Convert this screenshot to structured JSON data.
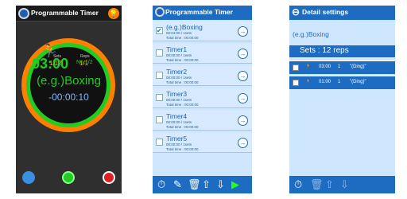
{
  "screen1": {
    "title": "Programmable Timer",
    "sets_label": "Sets",
    "sets_value": "1/12",
    "reps_label": "Reps",
    "reps_value": "1/1",
    "time": "03:00",
    "round": "No.1/2",
    "event": "(e.g.)Boxing",
    "remaining": "-00:00:10"
  },
  "screen2": {
    "title": "Programmable Timer",
    "timers": [
      {
        "name": "(e.g.)Boxing",
        "line1": "00:04:00 / 1sets",
        "line2": "Total time : 00:00:00",
        "checked": true
      },
      {
        "name": "Timer1",
        "line1": "00:00:00 / 1sets",
        "line2": "Total time : 00:00:00",
        "checked": false
      },
      {
        "name": "Timer2",
        "line1": "00:00:00 / 1sets",
        "line2": "Total time : 00:00:00",
        "checked": false
      },
      {
        "name": "Timer3",
        "line1": "00:00:00 / 1sets",
        "line2": "Total time : 00:00:00",
        "checked": false
      },
      {
        "name": "Timer4",
        "line1": "00:00:00 / 1sets",
        "line2": "Total time : 00:00:00",
        "checked": false
      },
      {
        "name": "Timer5",
        "line1": "00:00:00 / 1sets",
        "line2": "Total time : 00:00:00",
        "checked": false
      }
    ]
  },
  "screen3": {
    "title": "Detail settings",
    "name": "(e.g.)Boxing",
    "sets": "Sets : 12 reps",
    "rows": [
      {
        "time": "03:00",
        "count": "1",
        "sound": "\"(Ding)\""
      },
      {
        "time": "01:00",
        "count": "1",
        "sound": "\"(Ding)\""
      }
    ]
  },
  "colors": {
    "accent": "#1e6cc2",
    "green": "#22cc22",
    "orange": "#ff7f00"
  }
}
